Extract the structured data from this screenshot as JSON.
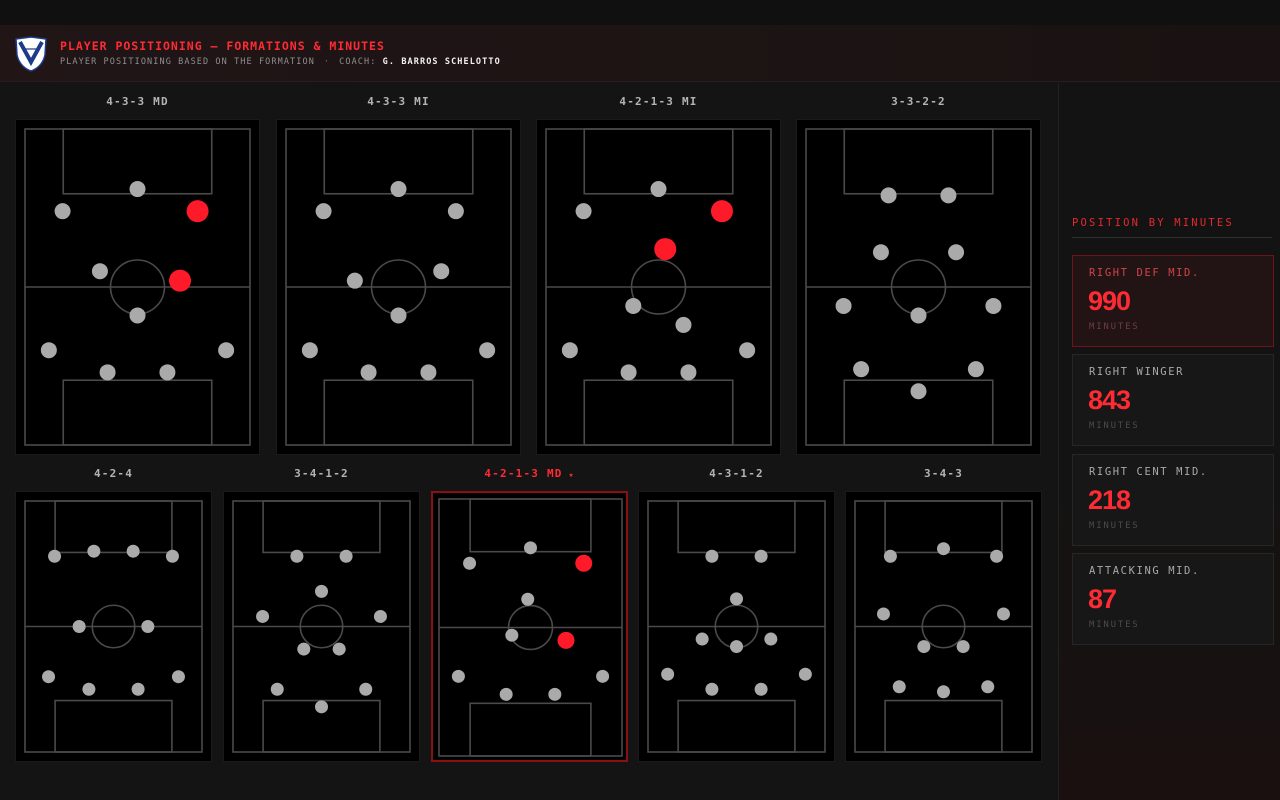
{
  "header": {
    "title": "PLAYER POSITIONING — FORMATIONS & MINUTES",
    "subtitle": "PLAYER POSITIONING BASED ON THE FORMATION",
    "separator": "·",
    "coach_prefix": "COACH:",
    "coach_name": "G. BARROS SCHELOTTO",
    "logo_icon": "club-crest-shield-icon"
  },
  "colors": {
    "accent": "#ff2b34",
    "player_dot": "#aaaaaa",
    "highlight_dot": "#ff1a2a"
  },
  "formations": [
    {
      "label": "4-3-3 MD",
      "players": [
        [
          0.5,
          0.19,
          0
        ],
        [
          0.167,
          0.26,
          0
        ],
        [
          0.767,
          0.26,
          1
        ],
        [
          0.333,
          0.45,
          0
        ],
        [
          0.689,
          0.48,
          1
        ],
        [
          0.5,
          0.59,
          0
        ],
        [
          0.106,
          0.7,
          0
        ],
        [
          0.894,
          0.7,
          0
        ],
        [
          0.367,
          0.77,
          0
        ],
        [
          0.633,
          0.77,
          0
        ]
      ]
    },
    {
      "label": "4-3-3 MI",
      "players": [
        [
          0.5,
          0.19,
          0
        ],
        [
          0.167,
          0.26,
          0
        ],
        [
          0.755,
          0.26,
          0
        ],
        [
          0.306,
          0.48,
          0
        ],
        [
          0.69,
          0.45,
          0
        ],
        [
          0.5,
          0.59,
          0
        ],
        [
          0.106,
          0.7,
          0
        ],
        [
          0.894,
          0.7,
          0
        ],
        [
          0.367,
          0.77,
          0
        ],
        [
          0.633,
          0.77,
          0
        ]
      ]
    },
    {
      "label": "4-2-1-3 MI",
      "players": [
        [
          0.5,
          0.19,
          0
        ],
        [
          0.167,
          0.26,
          0
        ],
        [
          0.782,
          0.26,
          1
        ],
        [
          0.53,
          0.38,
          1
        ],
        [
          0.388,
          0.56,
          0
        ],
        [
          0.611,
          0.62,
          0
        ],
        [
          0.106,
          0.7,
          0
        ],
        [
          0.894,
          0.7,
          0
        ],
        [
          0.367,
          0.77,
          0
        ],
        [
          0.633,
          0.77,
          0
        ]
      ]
    },
    {
      "label": "3-3-2-2",
      "players": [
        [
          0.367,
          0.21,
          0
        ],
        [
          0.633,
          0.21,
          0
        ],
        [
          0.333,
          0.39,
          0
        ],
        [
          0.667,
          0.39,
          0
        ],
        [
          0.167,
          0.56,
          0
        ],
        [
          0.5,
          0.59,
          0
        ],
        [
          0.833,
          0.56,
          0
        ],
        [
          0.245,
          0.76,
          0
        ],
        [
          0.755,
          0.76,
          0
        ],
        [
          0.5,
          0.83,
          0
        ]
      ]
    },
    {
      "label": "4-2-4",
      "players": [
        [
          0.167,
          0.22,
          0
        ],
        [
          0.389,
          0.2,
          0
        ],
        [
          0.611,
          0.2,
          0
        ],
        [
          0.833,
          0.22,
          0
        ],
        [
          0.306,
          0.5,
          0
        ],
        [
          0.694,
          0.5,
          0
        ],
        [
          0.133,
          0.7,
          0
        ],
        [
          0.361,
          0.75,
          0
        ],
        [
          0.639,
          0.75,
          0
        ],
        [
          0.867,
          0.7,
          0
        ]
      ]
    },
    {
      "label": "3-4-1-2",
      "players": [
        [
          0.361,
          0.22,
          0
        ],
        [
          0.639,
          0.22,
          0
        ],
        [
          0.5,
          0.36,
          0
        ],
        [
          0.167,
          0.46,
          0
        ],
        [
          0.833,
          0.46,
          0
        ],
        [
          0.4,
          0.59,
          0
        ],
        [
          0.6,
          0.59,
          0
        ],
        [
          0.25,
          0.75,
          0
        ],
        [
          0.75,
          0.75,
          0
        ],
        [
          0.5,
          0.82,
          0
        ]
      ]
    },
    {
      "label": "4-2-1-3 MD",
      "active": true,
      "players": [
        [
          0.5,
          0.19,
          0
        ],
        [
          0.167,
          0.25,
          0
        ],
        [
          0.791,
          0.25,
          1
        ],
        [
          0.485,
          0.39,
          0
        ],
        [
          0.398,
          0.53,
          0
        ],
        [
          0.694,
          0.55,
          1
        ],
        [
          0.106,
          0.69,
          0
        ],
        [
          0.894,
          0.69,
          0
        ],
        [
          0.367,
          0.76,
          0
        ],
        [
          0.633,
          0.76,
          0
        ]
      ]
    },
    {
      "label": "4-3-1-2",
      "players": [
        [
          0.361,
          0.22,
          0
        ],
        [
          0.639,
          0.22,
          0
        ],
        [
          0.5,
          0.39,
          0
        ],
        [
          0.306,
          0.55,
          0
        ],
        [
          0.694,
          0.55,
          0
        ],
        [
          0.5,
          0.58,
          0
        ],
        [
          0.111,
          0.69,
          0
        ],
        [
          0.889,
          0.69,
          0
        ],
        [
          0.361,
          0.75,
          0
        ],
        [
          0.639,
          0.75,
          0
        ]
      ]
    },
    {
      "label": "3-4-3",
      "players": [
        [
          0.2,
          0.22,
          0
        ],
        [
          0.5,
          0.19,
          0
        ],
        [
          0.8,
          0.22,
          0
        ],
        [
          0.161,
          0.45,
          0
        ],
        [
          0.839,
          0.45,
          0
        ],
        [
          0.389,
          0.58,
          0
        ],
        [
          0.611,
          0.58,
          0
        ],
        [
          0.25,
          0.74,
          0
        ],
        [
          0.5,
          0.76,
          0
        ],
        [
          0.75,
          0.74,
          0
        ]
      ]
    }
  ],
  "sidebar": {
    "title": "POSITION BY MINUTES",
    "stats": [
      {
        "label": "RIGHT DEF MID.",
        "value": "990",
        "unit": "MINUTES",
        "active": true
      },
      {
        "label": "RIGHT WINGER",
        "value": "843",
        "unit": "MINUTES"
      },
      {
        "label": "RIGHT CENT MID.",
        "value": "218",
        "unit": "MINUTES"
      },
      {
        "label": "ATTACKING MID.",
        "value": "87",
        "unit": "MINUTES"
      }
    ]
  }
}
